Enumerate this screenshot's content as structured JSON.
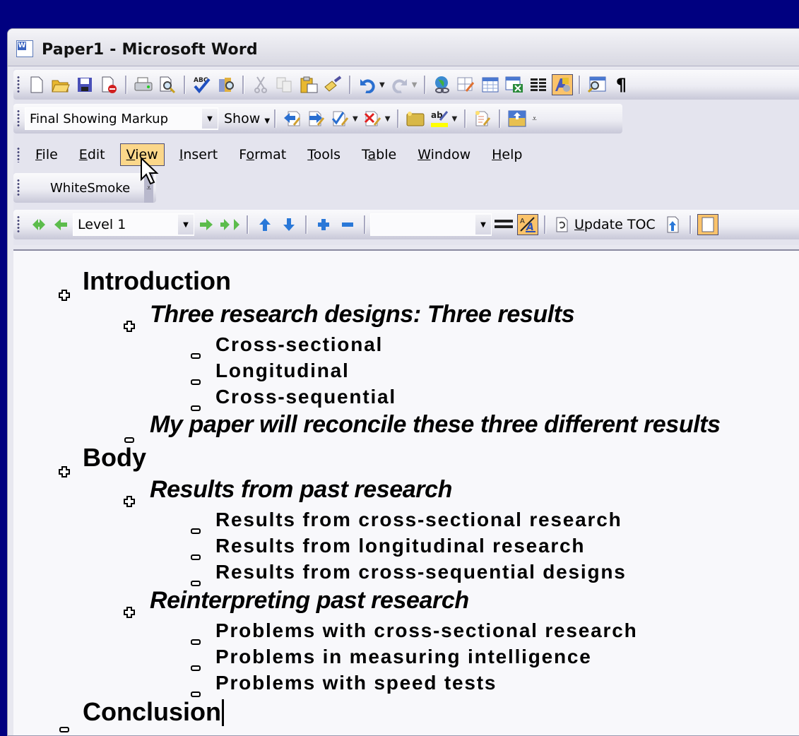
{
  "window": {
    "title": "Paper1 - Microsoft Word",
    "app_icon": "word-doc-icon"
  },
  "standard_toolbar": {
    "icons": [
      "new-icon",
      "open-icon",
      "save-icon",
      "permission-icon",
      "print-icon",
      "print-preview-icon",
      "spelling-icon",
      "research-icon",
      "cut-icon",
      "copy-icon",
      "paste-icon",
      "format-painter-icon",
      "undo-icon",
      "redo-icon",
      "hyperlink-icon",
      "tables-borders-icon",
      "insert-table-icon",
      "insert-excel-icon",
      "columns-icon",
      "drawing-icon",
      "document-map-icon",
      "show-hide-icon"
    ]
  },
  "reviewing_toolbar": {
    "display_mode": "Final Showing Markup",
    "show_label": "Show",
    "icons": [
      "previous-change-icon",
      "next-change-icon",
      "accept-change-icon",
      "reject-change-icon",
      "insert-comment-icon",
      "highlight-icon",
      "track-changes-icon",
      "reviewing-pane-icon"
    ],
    "highlight_color": "#ffff00"
  },
  "menubar": {
    "items": [
      {
        "label": "File",
        "key": "F"
      },
      {
        "label": "Edit",
        "key": "E"
      },
      {
        "label": "View",
        "key": "V",
        "active": true
      },
      {
        "label": "Insert",
        "key": "I"
      },
      {
        "label": "Format",
        "key": "o"
      },
      {
        "label": "Tools",
        "key": "T"
      },
      {
        "label": "Table",
        "key": "a"
      },
      {
        "label": "Window",
        "key": "W"
      },
      {
        "label": "Help",
        "key": "H"
      }
    ]
  },
  "color_toolbar": {
    "label": "WhiteSmoke"
  },
  "outlining_toolbar": {
    "level_value": "Level 1",
    "show_level_value": "",
    "update_toc_label": "Update TOC",
    "icons": [
      "promote-to-heading1-icon",
      "promote-icon",
      "demote-icon",
      "demote-to-body-icon",
      "move-up-icon",
      "move-down-icon",
      "expand-icon",
      "collapse-icon",
      "show-first-line-icon",
      "show-formatting-icon",
      "update-toc-icon",
      "go-to-toc-icon",
      "master-document-view-icon"
    ]
  },
  "document": {
    "outline": [
      {
        "level": 1,
        "symbol": "plus",
        "text": "Introduction"
      },
      {
        "level": 2,
        "symbol": "plus",
        "text": "Three research designs: Three results"
      },
      {
        "level": 3,
        "symbol": "minus",
        "text": "Cross-sectional"
      },
      {
        "level": 3,
        "symbol": "minus",
        "text": "Longitudinal"
      },
      {
        "level": 3,
        "symbol": "minus",
        "text": "Cross-sequential"
      },
      {
        "level": 2,
        "symbol": "minus",
        "text": "My paper will reconcile these three different results"
      },
      {
        "level": 1,
        "symbol": "plus",
        "text": "Body"
      },
      {
        "level": 2,
        "symbol": "plus",
        "text": "Results from past research"
      },
      {
        "level": 3,
        "symbol": "minus",
        "text": "Results from cross-sectional research"
      },
      {
        "level": 3,
        "symbol": "minus",
        "text": "Results from longitudinal research"
      },
      {
        "level": 3,
        "symbol": "minus",
        "text": "Results from cross-sequential designs"
      },
      {
        "level": 2,
        "symbol": "plus",
        "text": "Reinterpreting past research"
      },
      {
        "level": 3,
        "symbol": "minus",
        "text": "Problems with cross-sectional research"
      },
      {
        "level": 3,
        "symbol": "minus",
        "text": "Problems in measuring intelligence"
      },
      {
        "level": 3,
        "symbol": "minus",
        "text": "Problems with speed tests"
      },
      {
        "level": 1,
        "symbol": "minus",
        "text": "Conclusion"
      }
    ]
  }
}
